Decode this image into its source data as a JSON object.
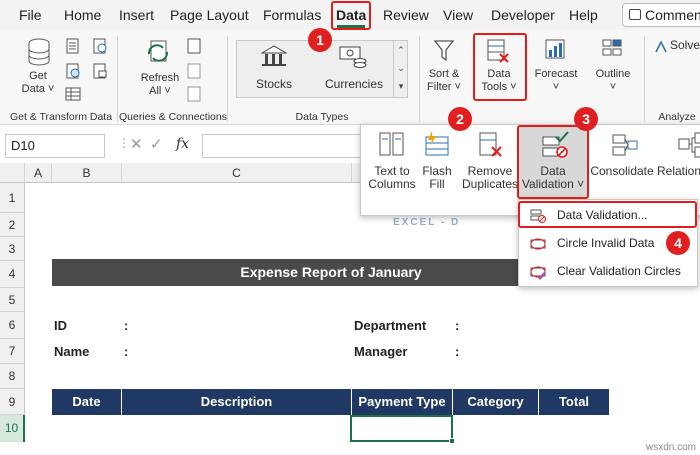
{
  "menu_tabs": [
    "File",
    "Home",
    "Insert",
    "Page Layout",
    "Formulas",
    "Data",
    "Review",
    "View",
    "Developer",
    "Help"
  ],
  "comments_label": "Commen",
  "ribbon": {
    "get_data": [
      "Get",
      "Data ˅"
    ],
    "refresh_all": [
      "Refresh",
      "All ˅"
    ],
    "stocks": "Stocks",
    "currencies": "Currencies",
    "sort_filter": [
      "Sort &",
      "Filter ˅"
    ],
    "data_tools": [
      "Data",
      "Tools ˅"
    ],
    "forecast": [
      "Forecast",
      "˅"
    ],
    "outline": [
      "Outline",
      "˅"
    ],
    "solver": "Solve",
    "groups": {
      "get_transform": "Get & Transform Data",
      "queries": "Queries & Connections",
      "data_types": "Data Types",
      "analyze": "Analyze"
    }
  },
  "formula_bar": {
    "name_box": "D10",
    "fx": "fx"
  },
  "data_tools_panel": {
    "text_to_columns": [
      "Text to",
      "Columns"
    ],
    "flash_fill": [
      "Flash",
      "Fill"
    ],
    "remove_duplicates": [
      "Remove",
      "Duplicates"
    ],
    "data_validation": [
      "Data",
      "Validation ˅"
    ],
    "consolidate": "Consolidate",
    "relationships": "Relation"
  },
  "validation_menu": [
    "Data Validation...",
    "Circle Invalid Data",
    "Clear Validation Circles"
  ],
  "columns": [
    "A",
    "B",
    "C"
  ],
  "rows": [
    "1",
    "2",
    "3",
    "4",
    "5",
    "6",
    "7",
    "8",
    "9",
    "10"
  ],
  "sheet": {
    "title": "Expense Report of January",
    "id_label": "ID",
    "name_label": "Name",
    "department_label": "Department",
    "manager_label": "Manager",
    "colon": ":",
    "table_headers": [
      "Date",
      "Description",
      "Payment Type",
      "Category",
      "Total"
    ]
  },
  "callouts": [
    "1",
    "2",
    "3",
    "4"
  ],
  "watermark": "EXCEL - D",
  "site": "wsxdn.com",
  "colors": {
    "accent": "#1e7145",
    "callout": "#e21b1b",
    "header_dark": "#1f3864",
    "title_bar": "#4a4a4a"
  }
}
